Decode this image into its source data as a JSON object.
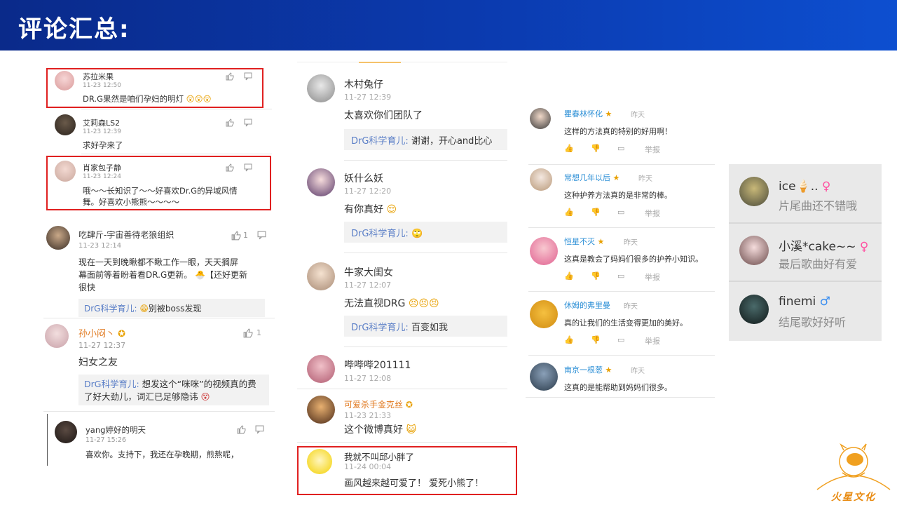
{
  "header": {
    "title": "评论汇总:"
  },
  "panel1": {
    "comments": [
      {
        "name": "苏拉米果",
        "time": "11-23 12:50",
        "text": "DR.G果然是咱们孕妇的明灯"
      },
      {
        "name": "艾莉森LS2",
        "time": "11-23 12:39",
        "text": "求好孕来了"
      },
      {
        "name": "肖家包子静",
        "time": "11-23 12:24",
        "text1": "哦～～长知识了～～好喜欢Dr.G的异域风情",
        "text2": "舞。好喜欢小熊熊～～～～"
      }
    ]
  },
  "panel1b": {
    "comments": [
      {
        "name": "吃肆斤-宇宙善待老狼组织",
        "time": "11-23 12:14",
        "like_count": "1",
        "text1": "现在一天到晚瞅都不瞅工作一眼，天天搁屏",
        "text2": "幕面前等着盼着看DR.G更新。",
        "text2b": "【还好更新",
        "text3": "很快",
        "reply_name": "DrG科学育儿:",
        "reply_text": "别被boss发现"
      },
      {
        "name": "孙小闷丶",
        "time": "11-27 12:37",
        "like_count": "1",
        "text": "妇女之友",
        "reply_name": "DrG科学育儿:",
        "reply_text1": "想发这个“咪咪”的视频真的费",
        "reply_text2": "了好大劲儿，词汇已足够隐讳"
      },
      {
        "name": "yang婷好的明天",
        "time": "11-27 15:26",
        "text": "喜欢你。支持下，我还在孕晚期，煎熬呢，"
      }
    ]
  },
  "panel2": {
    "comments": [
      {
        "name": "木村兔仔",
        "time": "11-27 12:39",
        "text": "太喜欢你们团队了",
        "reply_name": "DrG科学育儿:",
        "reply_text": "谢谢，开心and比心"
      },
      {
        "name": "妖什么妖",
        "time": "11-27 12:20",
        "text": "有你真好",
        "reply_name": "DrG科学育儿:",
        "reply_text": ""
      },
      {
        "name": "牛家大闺女",
        "time": "11-27 12:07",
        "text": "无法直视DRG",
        "reply_name": "DrG科学育儿:",
        "reply_text": "百变如我"
      },
      {
        "name": "哔哔哔201111",
        "time": "11-27 12:08"
      },
      {
        "name": "可爱杀手金克丝",
        "time": "11-23 21:33",
        "text": "这个微博真好"
      },
      {
        "name": "我就不叫邱小胖了",
        "time": "11-24 00:04",
        "text": "画风越来越可爱了！ 爱死小熊了！"
      }
    ]
  },
  "panel3": {
    "comments": [
      {
        "name": "瞿春林怀化",
        "time": "昨天",
        "text": "这样的方法真的特别的好用啊！",
        "report": "举报"
      },
      {
        "name": "常想几年以后",
        "time": "昨天",
        "text": "这种护养方法真的是非常的棒。",
        "report": "举报"
      },
      {
        "name": "恒星不灭",
        "time": "昨天",
        "text": "这真是教会了妈妈们很多的护养小知识。",
        "report": "举报"
      },
      {
        "name": "休姆的弗里曼",
        "time": "昨天",
        "text": "真的让我们的生活变得更加的美好。",
        "report": "举报"
      },
      {
        "name": "南京一根葱",
        "time": "昨天",
        "text": "这真的是能帮助到妈妈们很多。"
      }
    ]
  },
  "panel4": {
    "comments": [
      {
        "name": "ice",
        "suffix": "..",
        "gender": "♀",
        "text": "片尾曲还不错哦"
      },
      {
        "name": "小溪*cake~~",
        "gender": "♀",
        "text": "最后歌曲好有爱"
      },
      {
        "name": "finemi",
        "gender": "♂",
        "text": "结尾歌好好听"
      }
    ]
  },
  "logo": {
    "text": "火星文化"
  },
  "colors": {
    "header": "#0b3bb0",
    "highlight": "#e02020",
    "link": "#5b7fc7",
    "name_blue": "#2c8fd6"
  }
}
